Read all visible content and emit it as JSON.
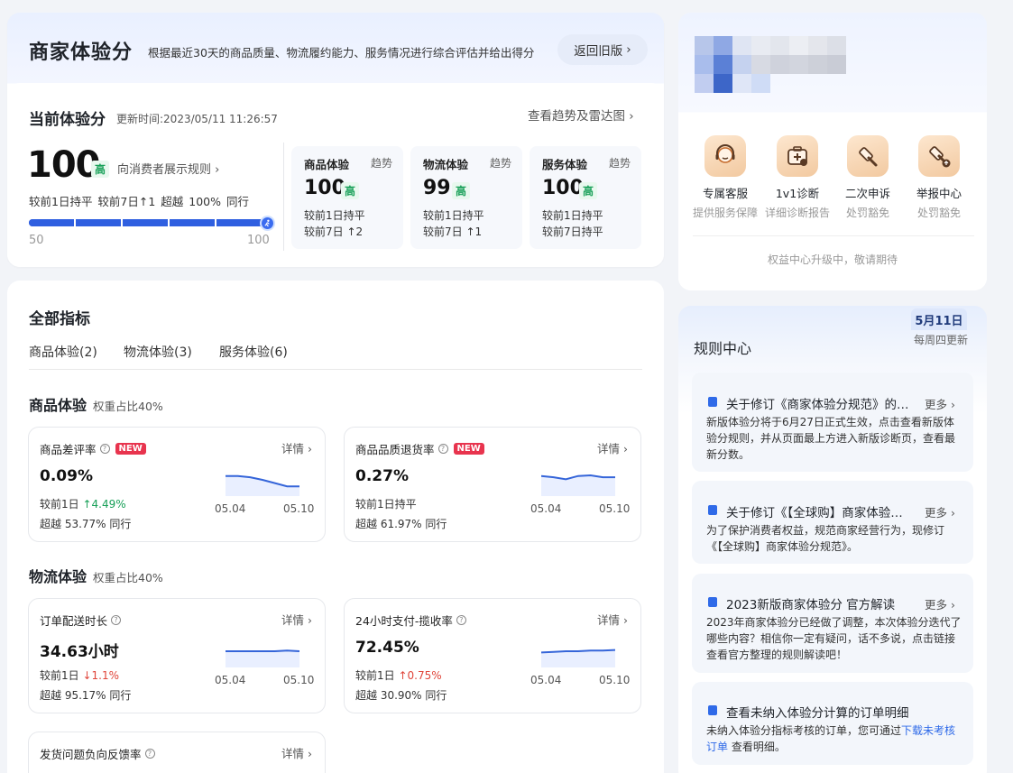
{
  "header": {
    "title": "商家体验分",
    "description": "根据最近30天的商品质量、物流履约能力、服务情况进行综合评估并给出得分",
    "old_version_label": "返回旧版"
  },
  "current": {
    "title": "当前体验分",
    "update_time": "更新时间:2023/05/11 11:26:57",
    "trend_link": "查看趋势及雷达图",
    "score": "100",
    "level": "高",
    "consumer_rule": "向消费者展示规则",
    "compare_line": "较前1日持平  较前7日↑1  超越 100% 同行",
    "progress": {
      "min": "50",
      "max": "100",
      "value": 100
    }
  },
  "subscores": [
    {
      "name": "商品体验",
      "trend": "趋势",
      "score": "100",
      "level": "高",
      "line1": "较前1日持平",
      "line2": "较前7日 ↑2"
    },
    {
      "name": "物流体验",
      "trend": "趋势",
      "score": "99",
      "level": "高",
      "line1": "较前1日持平",
      "line2": "较前7日 ↑1"
    },
    {
      "name": "服务体验",
      "trend": "趋势",
      "score": "100",
      "level": "高",
      "line1": "较前1日持平",
      "line2": "较前7日持平"
    }
  ],
  "indicators": {
    "title": "全部指标",
    "tabs": [
      "商品体验(2)",
      "物流体验(3)",
      "服务体验(6)"
    ],
    "sections": [
      {
        "title": "商品体验",
        "weight": "权重占比40%"
      },
      {
        "title": "物流体验",
        "weight": "权重占比40%"
      }
    ],
    "metrics": [
      {
        "name": "商品差评率",
        "new": "NEW",
        "detail": "详情",
        "value": "0.09%",
        "l1_prefix": "较前1日",
        "l1_change": "↑4.49%",
        "l2": "超越 53.77% 同行",
        "d1": "05.04",
        "d2": "05.10",
        "spark": [
          0.62,
          0.62,
          0.58,
          0.5,
          0.4,
          0.3,
          0.3
        ]
      },
      {
        "name": "商品品质退货率",
        "new": "NEW",
        "detail": "详情",
        "value": "0.27%",
        "l1_prefix": "较前1日持平",
        "l1_change": "",
        "l2": "超越 61.97% 同行",
        "d1": "05.04",
        "d2": "05.10",
        "spark": [
          0.62,
          0.58,
          0.52,
          0.62,
          0.64,
          0.58,
          0.58
        ]
      },
      {
        "name": "订单配送时长",
        "new": "",
        "detail": "详情",
        "value": "34.63小时",
        "l1_prefix": "较前1日",
        "l1_change": "↓1.1%",
        "l2": "超越 95.17% 同行",
        "d1": "05.04",
        "d2": "05.10",
        "spark": [
          0.5,
          0.5,
          0.5,
          0.5,
          0.5,
          0.52,
          0.5
        ]
      },
      {
        "name": "24小时支付-揽收率",
        "new": "",
        "detail": "详情",
        "value": "72.45%",
        "l1_prefix": "较前1日",
        "l1_change": "↑0.75%",
        "l2": "超越 30.90% 同行",
        "d1": "05.04",
        "d2": "05.10",
        "spark": [
          0.46,
          0.48,
          0.5,
          0.5,
          0.52,
          0.52,
          0.54
        ]
      },
      {
        "name": "发货问题负向反馈率",
        "new": "",
        "detail": "详情"
      }
    ]
  },
  "benefits": {
    "items": [
      {
        "name": "专属客服",
        "desc": "提供服务保障",
        "icon": "headset-icon"
      },
      {
        "name": "1v1诊断",
        "desc": "详细诊断报告",
        "icon": "medical-kit-icon"
      },
      {
        "name": "二次申诉",
        "desc": "处罚豁免",
        "icon": "gavel-icon"
      },
      {
        "name": "举报中心",
        "desc": "处罚豁免",
        "icon": "report-gavel-icon"
      }
    ],
    "tip": "权益中心升级中，敬请期待"
  },
  "rules": {
    "title": "规则中心",
    "date": "5月11日",
    "date_sub": "每周四更新",
    "more_label": "更多",
    "items": [
      {
        "title": "关于修订《商家体验分规范》的…",
        "body": "新版体验分将于6月27日正式生效，点击查看新版体验分规则，并从页面最上方进入新版诊断页，查看最新分数。"
      },
      {
        "title": "关于修订《【全球购】商家体验…",
        "body": "为了保护消费者权益，规范商家经营行为，现修订《【全球购】商家体验分规范》。"
      },
      {
        "title": "2023新版商家体验分 官方解读",
        "body": "2023年商家体验分已经做了调整，本次体验分迭代了哪些内容？相信你一定有疑问，话不多说，点击链接查看官方整理的规则解读吧！"
      },
      {
        "title": "查看未纳入体验分计算的订单明细",
        "body_prefix": "未纳入体验分指标考核的订单，您可通过",
        "body_link": "下载未考核订单",
        "body_suffix": "查看明细。"
      }
    ]
  },
  "colors": {
    "accent": "#2f5fe0",
    "high_green": "#18a058",
    "new_red": "#e8344e",
    "down_red": "#e0453a"
  }
}
